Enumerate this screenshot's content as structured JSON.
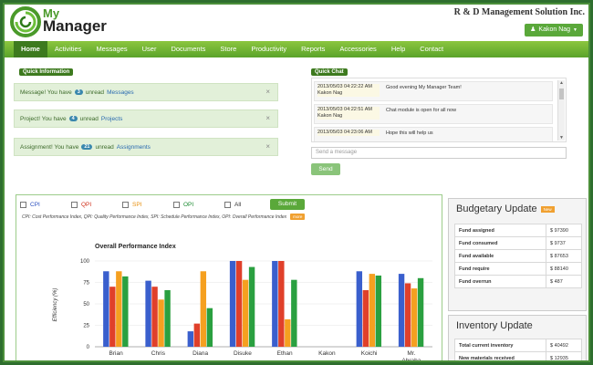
{
  "brand": {
    "line1": "My",
    "line2": "Manager"
  },
  "company": "R & D Management Solution Inc.",
  "user": {
    "name": "Kakon Nag"
  },
  "nav": [
    "Home",
    "Activities",
    "Messages",
    "User",
    "Documents",
    "Store",
    "Productivity",
    "Reports",
    "Accessories",
    "Help",
    "Contact"
  ],
  "quick_info": {
    "title": "Quick Information",
    "alerts": [
      {
        "prefix": "Message! You have",
        "count": "3",
        "mid": "unread",
        "link": "Messages"
      },
      {
        "prefix": "Project! You have",
        "count": "4",
        "mid": "unread",
        "link": "Projects"
      },
      {
        "prefix": "Assignment! You have",
        "count": "21",
        "mid": "unread",
        "link": "Assignments"
      }
    ]
  },
  "quick_chat": {
    "title": "Quick Chat",
    "messages": [
      {
        "time": "2013/05/03 04:22:22 AM",
        "user": "Kakon Nag",
        "text": "Good evening My Manager Team!"
      },
      {
        "time": "2013/05/03 04:22:51 AM",
        "user": "Kakon Nag",
        "text": "Chat module is open for all now"
      },
      {
        "time": "2013/05/03 04:23:06 AM",
        "user": "",
        "text": "Hope this will help us"
      }
    ],
    "placeholder": "Send a message",
    "send_label": "Send"
  },
  "performance": {
    "filters": [
      "CPI",
      "QPI",
      "SPI",
      "OPI",
      "All"
    ],
    "submit_label": "Submit",
    "legend_note": "CPI: Cost Performance Index, QPI: Quality Performance Index, SPI: Schedule Performance Index, OPI: Overall Performance Index",
    "more_label": "more"
  },
  "chart_data": {
    "type": "bar",
    "title": "Overall Performance Index",
    "ylabel": "Efficiency (%)",
    "ylim": [
      0,
      100
    ],
    "yticks": [
      "0",
      "25",
      "50",
      "75",
      "100"
    ],
    "categories": [
      "Brian",
      "Chris",
      "Diana",
      "Disuke",
      "Ethan",
      "Kakon",
      "Koichi",
      "Mr. Abraha"
    ],
    "series": [
      {
        "color": "#3a5fcd",
        "values": [
          88,
          77,
          18,
          100,
          100,
          0,
          88,
          85
        ]
      },
      {
        "color": "#e0402a",
        "values": [
          70,
          70,
          27,
          100,
          100,
          0,
          66,
          74
        ]
      },
      {
        "color": "#f5a020",
        "values": [
          88,
          55,
          88,
          78,
          32,
          0,
          85,
          68
        ]
      },
      {
        "color": "#2aa040",
        "values": [
          82,
          66,
          45,
          93,
          78,
          0,
          83,
          80
        ]
      }
    ]
  },
  "budget": {
    "title": "Budgetary Update",
    "tag": "New",
    "rows": [
      {
        "label": "Fund assigned",
        "value": "$ 97390"
      },
      {
        "label": "Fund consumed",
        "value": "$ 9737"
      },
      {
        "label": "Fund available",
        "value": "$ 87653"
      },
      {
        "label": "Fund require",
        "value": "$ 88140"
      },
      {
        "label": "Fund overrun",
        "value": "$ 487"
      }
    ]
  },
  "inventory": {
    "title": "Inventory Update",
    "rows": [
      {
        "label": "Total current inventory",
        "value": "$ 40492"
      },
      {
        "label": "New materials received",
        "value": "$ 12935"
      }
    ]
  },
  "colors": {
    "accent": "#5aa83a",
    "nav_active": "#3d7a1e",
    "frame": "#2e6e2e"
  }
}
